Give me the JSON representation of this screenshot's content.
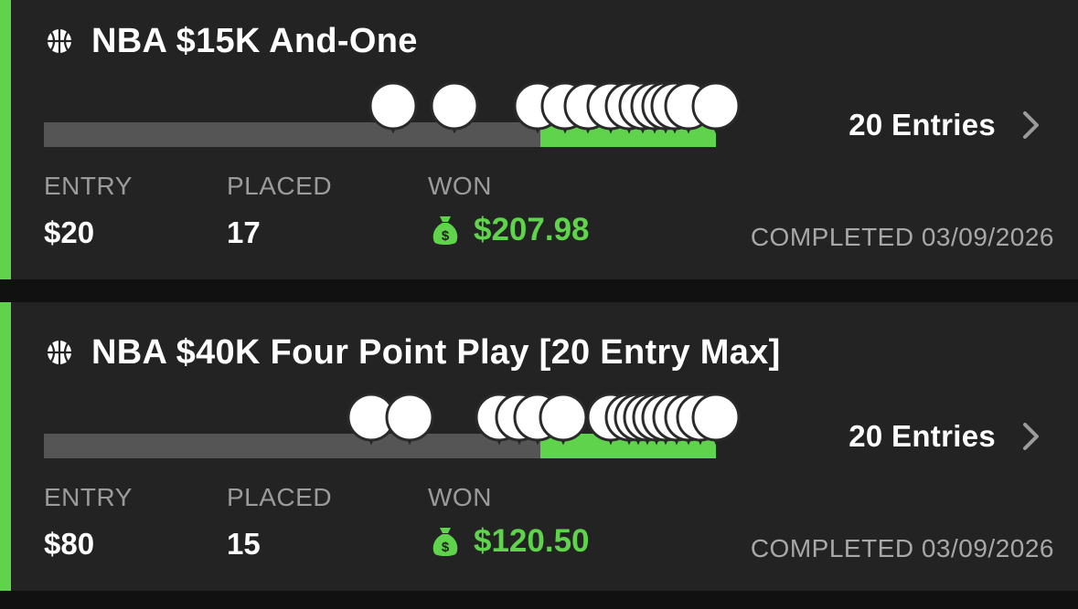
{
  "contests": [
    {
      "title": "NBA $15K And-One",
      "sport_icon": "basketball-icon",
      "entries_label": "20 Entries",
      "entry_label": "ENTRY",
      "entry_value": "$20",
      "placed_label": "PLACED",
      "placed_value": "17",
      "won_label": "WON",
      "won_value": "$207.98",
      "completed_text": "COMPLETED 03/09/2026"
    },
    {
      "title": "NBA $40K Four Point Play [20 Entry Max]",
      "sport_icon": "basketball-icon",
      "entries_label": "20 Entries",
      "entry_label": "ENTRY",
      "entry_value": "$80",
      "placed_label": "PLACED",
      "placed_value": "15",
      "won_label": "WON",
      "won_value": "$120.50",
      "completed_text": "COMPLETED 03/09/2026"
    }
  ],
  "colors": {
    "accent": "#5fd34b",
    "card_bg": "#232323",
    "track": "#555555",
    "label": "#9b9b9b"
  }
}
